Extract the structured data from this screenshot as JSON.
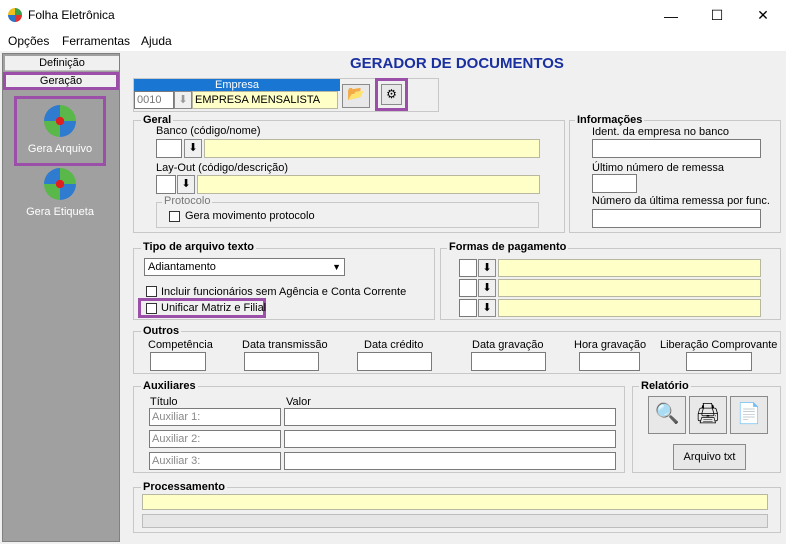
{
  "window": {
    "title": "Folha Eletrônica",
    "minimize": "—",
    "maximize": "☐",
    "close": "✕"
  },
  "menu": [
    {
      "label": "Opções"
    },
    {
      "label": "Ferramentas"
    },
    {
      "label": "Ajuda"
    }
  ],
  "sidebar": {
    "tab_definicao": "Definição",
    "tab_geracao": "Geração",
    "items": [
      {
        "label": "Gera Arquivo"
      },
      {
        "label": "Gera Etiqueta"
      }
    ]
  },
  "header": {
    "title": "GERADOR DE DOCUMENTOS"
  },
  "empresa": {
    "label": "Empresa",
    "code": "0010",
    "name": "EMPRESA MENSALISTA"
  },
  "geral": {
    "title": "Geral",
    "banco_label": "Banco (código/nome)",
    "layout_label": "Lay-Out (código/descrição)",
    "protocolo_title": "Protocolo",
    "gera_protocolo": "Gera movimento protocolo"
  },
  "informacoes": {
    "title": "Informações",
    "ident_label": "Ident. da empresa no banco",
    "ultimo_label": "Último número de remessa",
    "ultima_func_label": "Número da última remessa por func."
  },
  "tipo_arquivo": {
    "title": "Tipo de arquivo texto",
    "selected": "Adiantamento",
    "incluir": "Incluir funcionários sem Agência e Conta Corrente",
    "unificar": "Unificar Matriz e Filial"
  },
  "formas_pagamento": {
    "title": "Formas de pagamento"
  },
  "outros": {
    "title": "Outros",
    "labels": [
      "Competência",
      "Data transmissão",
      "Data crédito",
      "Data gravação",
      "Hora gravação",
      "Liberação Comprovante"
    ]
  },
  "auxiliares": {
    "title": "Auxiliares",
    "col_titulo": "Título",
    "col_valor": "Valor",
    "rows": [
      "Auxiliar 1:",
      "Auxiliar 2:",
      "Auxiliar 3:"
    ]
  },
  "relatorio": {
    "title": "Relatório",
    "arquivo_txt": "Arquivo txt"
  },
  "processamento": {
    "title": "Processamento"
  }
}
